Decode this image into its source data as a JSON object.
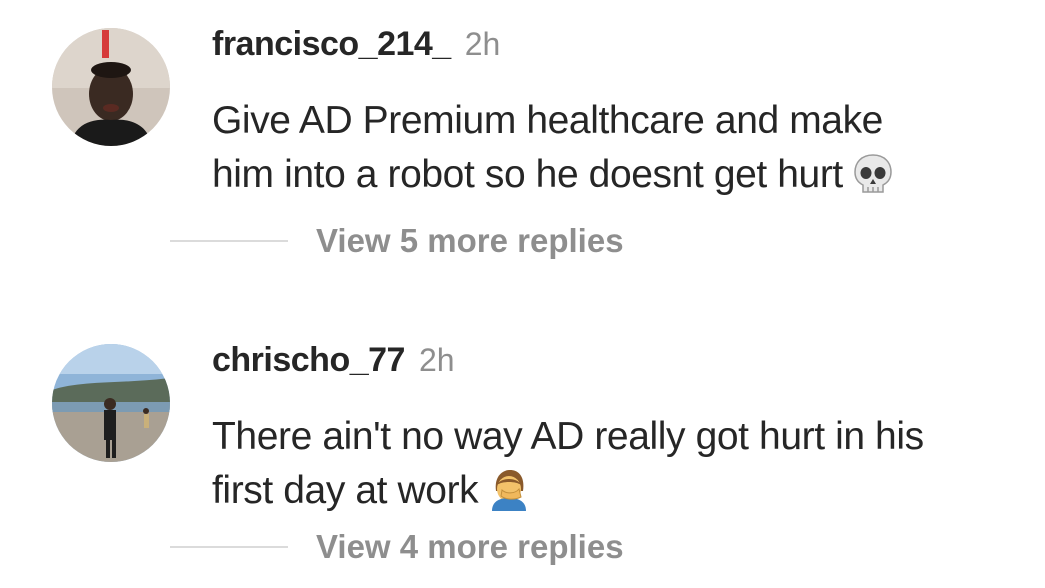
{
  "comments": [
    {
      "username": "francisco_214_",
      "time": "2h",
      "line1": "Give AD Premium healthcare and make",
      "line2": "him into a robot so he doesnt get hurt",
      "emoji": "skull-emoji",
      "replies": "View 5 more replies"
    },
    {
      "username": "chrischo_77",
      "time": "2h",
      "line1": "There ain't no way AD really got hurt in his",
      "line2": "first day at work",
      "emoji": "facepalm-emoji",
      "replies": "View 4 more replies"
    }
  ],
  "colors": {
    "text": "#262626",
    "muted": "#8e8e8e",
    "divider": "#dbdbdb"
  }
}
